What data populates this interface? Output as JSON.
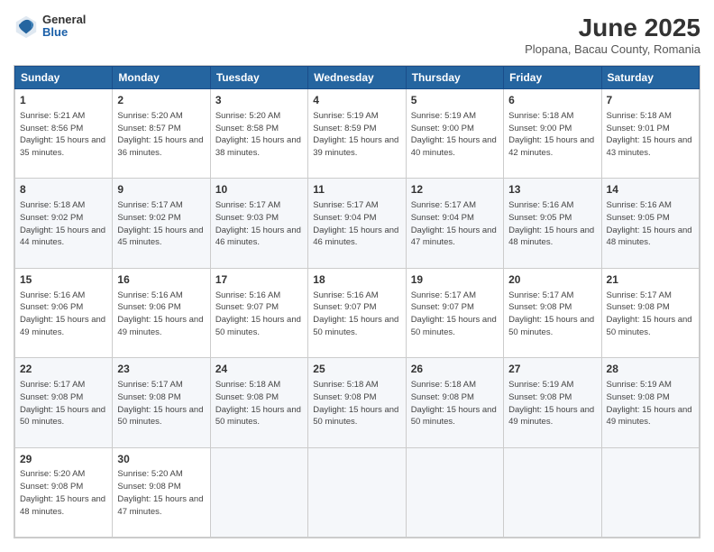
{
  "header": {
    "logo": {
      "general": "General",
      "blue": "Blue"
    },
    "title": "June 2025",
    "location": "Plopana, Bacau County, Romania"
  },
  "calendar": {
    "days_of_week": [
      "Sunday",
      "Monday",
      "Tuesday",
      "Wednesday",
      "Thursday",
      "Friday",
      "Saturday"
    ],
    "weeks": [
      [
        null,
        {
          "day": "2",
          "sunrise": "Sunrise: 5:20 AM",
          "sunset": "Sunset: 8:57 PM",
          "daylight": "Daylight: 15 hours and 36 minutes."
        },
        {
          "day": "3",
          "sunrise": "Sunrise: 5:20 AM",
          "sunset": "Sunset: 8:58 PM",
          "daylight": "Daylight: 15 hours and 38 minutes."
        },
        {
          "day": "4",
          "sunrise": "Sunrise: 5:19 AM",
          "sunset": "Sunset: 8:59 PM",
          "daylight": "Daylight: 15 hours and 39 minutes."
        },
        {
          "day": "5",
          "sunrise": "Sunrise: 5:19 AM",
          "sunset": "Sunset: 9:00 PM",
          "daylight": "Daylight: 15 hours and 40 minutes."
        },
        {
          "day": "6",
          "sunrise": "Sunrise: 5:18 AM",
          "sunset": "Sunset: 9:00 PM",
          "daylight": "Daylight: 15 hours and 42 minutes."
        },
        {
          "day": "7",
          "sunrise": "Sunrise: 5:18 AM",
          "sunset": "Sunset: 9:01 PM",
          "daylight": "Daylight: 15 hours and 43 minutes."
        }
      ],
      [
        {
          "day": "1",
          "sunrise": "Sunrise: 5:21 AM",
          "sunset": "Sunset: 8:56 PM",
          "daylight": "Daylight: 15 hours and 35 minutes."
        },
        {
          "day": "8",
          "sunrise": "Sunrise: 5:18 AM",
          "sunset": "Sunset: 9:02 PM",
          "daylight": "Daylight: 15 hours and 44 minutes."
        },
        {
          "day": "9",
          "sunrise": "Sunrise: 5:17 AM",
          "sunset": "Sunset: 9:02 PM",
          "daylight": "Daylight: 15 hours and 45 minutes."
        },
        {
          "day": "10",
          "sunrise": "Sunrise: 5:17 AM",
          "sunset": "Sunset: 9:03 PM",
          "daylight": "Daylight: 15 hours and 46 minutes."
        },
        {
          "day": "11",
          "sunrise": "Sunrise: 5:17 AM",
          "sunset": "Sunset: 9:04 PM",
          "daylight": "Daylight: 15 hours and 46 minutes."
        },
        {
          "day": "12",
          "sunrise": "Sunrise: 5:17 AM",
          "sunset": "Sunset: 9:04 PM",
          "daylight": "Daylight: 15 hours and 47 minutes."
        },
        {
          "day": "13",
          "sunrise": "Sunrise: 5:16 AM",
          "sunset": "Sunset: 9:05 PM",
          "daylight": "Daylight: 15 hours and 48 minutes."
        },
        {
          "day": "14",
          "sunrise": "Sunrise: 5:16 AM",
          "sunset": "Sunset: 9:05 PM",
          "daylight": "Daylight: 15 hours and 48 minutes."
        }
      ],
      [
        {
          "day": "15",
          "sunrise": "Sunrise: 5:16 AM",
          "sunset": "Sunset: 9:06 PM",
          "daylight": "Daylight: 15 hours and 49 minutes."
        },
        {
          "day": "16",
          "sunrise": "Sunrise: 5:16 AM",
          "sunset": "Sunset: 9:06 PM",
          "daylight": "Daylight: 15 hours and 49 minutes."
        },
        {
          "day": "17",
          "sunrise": "Sunrise: 5:16 AM",
          "sunset": "Sunset: 9:07 PM",
          "daylight": "Daylight: 15 hours and 50 minutes."
        },
        {
          "day": "18",
          "sunrise": "Sunrise: 5:16 AM",
          "sunset": "Sunset: 9:07 PM",
          "daylight": "Daylight: 15 hours and 50 minutes."
        },
        {
          "day": "19",
          "sunrise": "Sunrise: 5:17 AM",
          "sunset": "Sunset: 9:07 PM",
          "daylight": "Daylight: 15 hours and 50 minutes."
        },
        {
          "day": "20",
          "sunrise": "Sunrise: 5:17 AM",
          "sunset": "Sunset: 9:08 PM",
          "daylight": "Daylight: 15 hours and 50 minutes."
        },
        {
          "day": "21",
          "sunrise": "Sunrise: 5:17 AM",
          "sunset": "Sunset: 9:08 PM",
          "daylight": "Daylight: 15 hours and 50 minutes."
        }
      ],
      [
        {
          "day": "22",
          "sunrise": "Sunrise: 5:17 AM",
          "sunset": "Sunset: 9:08 PM",
          "daylight": "Daylight: 15 hours and 50 minutes."
        },
        {
          "day": "23",
          "sunrise": "Sunrise: 5:17 AM",
          "sunset": "Sunset: 9:08 PM",
          "daylight": "Daylight: 15 hours and 50 minutes."
        },
        {
          "day": "24",
          "sunrise": "Sunrise: 5:18 AM",
          "sunset": "Sunset: 9:08 PM",
          "daylight": "Daylight: 15 hours and 50 minutes."
        },
        {
          "day": "25",
          "sunrise": "Sunrise: 5:18 AM",
          "sunset": "Sunset: 9:08 PM",
          "daylight": "Daylight: 15 hours and 50 minutes."
        },
        {
          "day": "26",
          "sunrise": "Sunrise: 5:18 AM",
          "sunset": "Sunset: 9:08 PM",
          "daylight": "Daylight: 15 hours and 50 minutes."
        },
        {
          "day": "27",
          "sunrise": "Sunrise: 5:19 AM",
          "sunset": "Sunset: 9:08 PM",
          "daylight": "Daylight: 15 hours and 49 minutes."
        },
        {
          "day": "28",
          "sunrise": "Sunrise: 5:19 AM",
          "sunset": "Sunset: 9:08 PM",
          "daylight": "Daylight: 15 hours and 49 minutes."
        }
      ],
      [
        {
          "day": "29",
          "sunrise": "Sunrise: 5:20 AM",
          "sunset": "Sunset: 9:08 PM",
          "daylight": "Daylight: 15 hours and 48 minutes."
        },
        {
          "day": "30",
          "sunrise": "Sunrise: 5:20 AM",
          "sunset": "Sunset: 9:08 PM",
          "daylight": "Daylight: 15 hours and 47 minutes."
        },
        null,
        null,
        null,
        null,
        null
      ]
    ]
  }
}
